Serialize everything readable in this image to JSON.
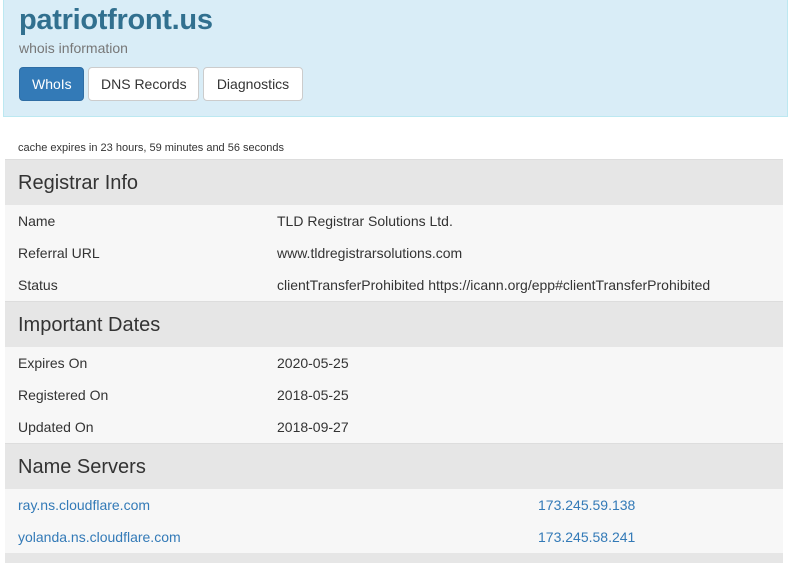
{
  "header": {
    "domain": "patriotfront.us",
    "subtitle": "whois information",
    "tabs": [
      {
        "label": "WhoIs",
        "active": true
      },
      {
        "label": "DNS Records",
        "active": false
      },
      {
        "label": "Diagnostics",
        "active": false
      }
    ]
  },
  "cache_note": "cache expires in 23 hours, 59 minutes and 56 seconds",
  "registrar": {
    "title": "Registrar Info",
    "rows": [
      {
        "key": "Name",
        "value": "TLD Registrar Solutions Ltd."
      },
      {
        "key": "Referral URL",
        "value": "www.tldregistrarsolutions.com"
      },
      {
        "key": "Status",
        "value": "clientTransferProhibited https://icann.org/epp#clientTransferProhibited"
      }
    ]
  },
  "dates": {
    "title": "Important Dates",
    "rows": [
      {
        "key": "Expires On",
        "value": "2020-05-25"
      },
      {
        "key": "Registered On",
        "value": "2018-05-25"
      },
      {
        "key": "Updated On",
        "value": "2018-09-27"
      }
    ]
  },
  "nameservers": {
    "title": "Name Servers",
    "rows": [
      {
        "host": "ray.ns.cloudflare.com",
        "ip": "173.245.59.138"
      },
      {
        "host": "yolanda.ns.cloudflare.com",
        "ip": "173.245.58.241"
      }
    ]
  },
  "colors": {
    "header_bg": "#d9edf7",
    "title_color": "#31708f",
    "active_tab": "#337ab7",
    "section_bg": "#e6e6e6",
    "row_bg": "#f7f7f7",
    "link": "#337ab7"
  }
}
